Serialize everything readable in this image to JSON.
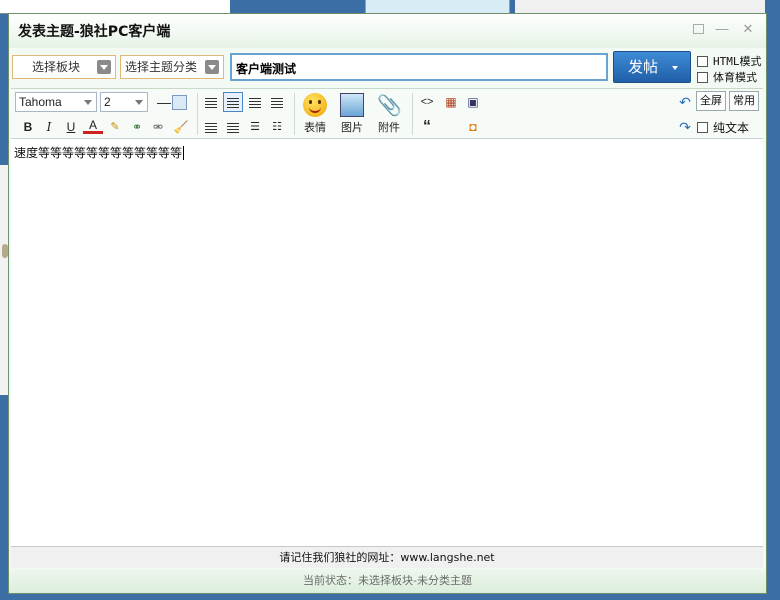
{
  "window": {
    "title": "发表主题-狼社PC客户端",
    "icons": [
      "restore-icon",
      "minimize-icon",
      "close-icon"
    ]
  },
  "topic_bar": {
    "board_select": "选择板块",
    "category_select": "选择主题分类",
    "title_value": "客户端测试",
    "post_button": "发帖",
    "html_mode_label": "HTML模式",
    "sports_mode_label": "体育模式"
  },
  "toolbar": {
    "font_family": "Tahoma",
    "font_size": "2",
    "emoticon_label": "表情",
    "image_label": "图片",
    "attachment_label": "附件",
    "fullscreen_label": "全屏",
    "common_label": "常用",
    "plain_text_label": "纯文本",
    "quote_glyph": "“",
    "code_glyph": "<>"
  },
  "editor": {
    "content": "速度等等等等等等等等等等等等"
  },
  "footer": {
    "tip": "请记住我们狼社的网址：www.langshe.net",
    "status": "当前状态：未选择板块-未分类主题"
  },
  "colors": {
    "desktop": "#3a6ea5",
    "post_button": "#2a6fbf",
    "dropdown_border": "#e0b878"
  }
}
